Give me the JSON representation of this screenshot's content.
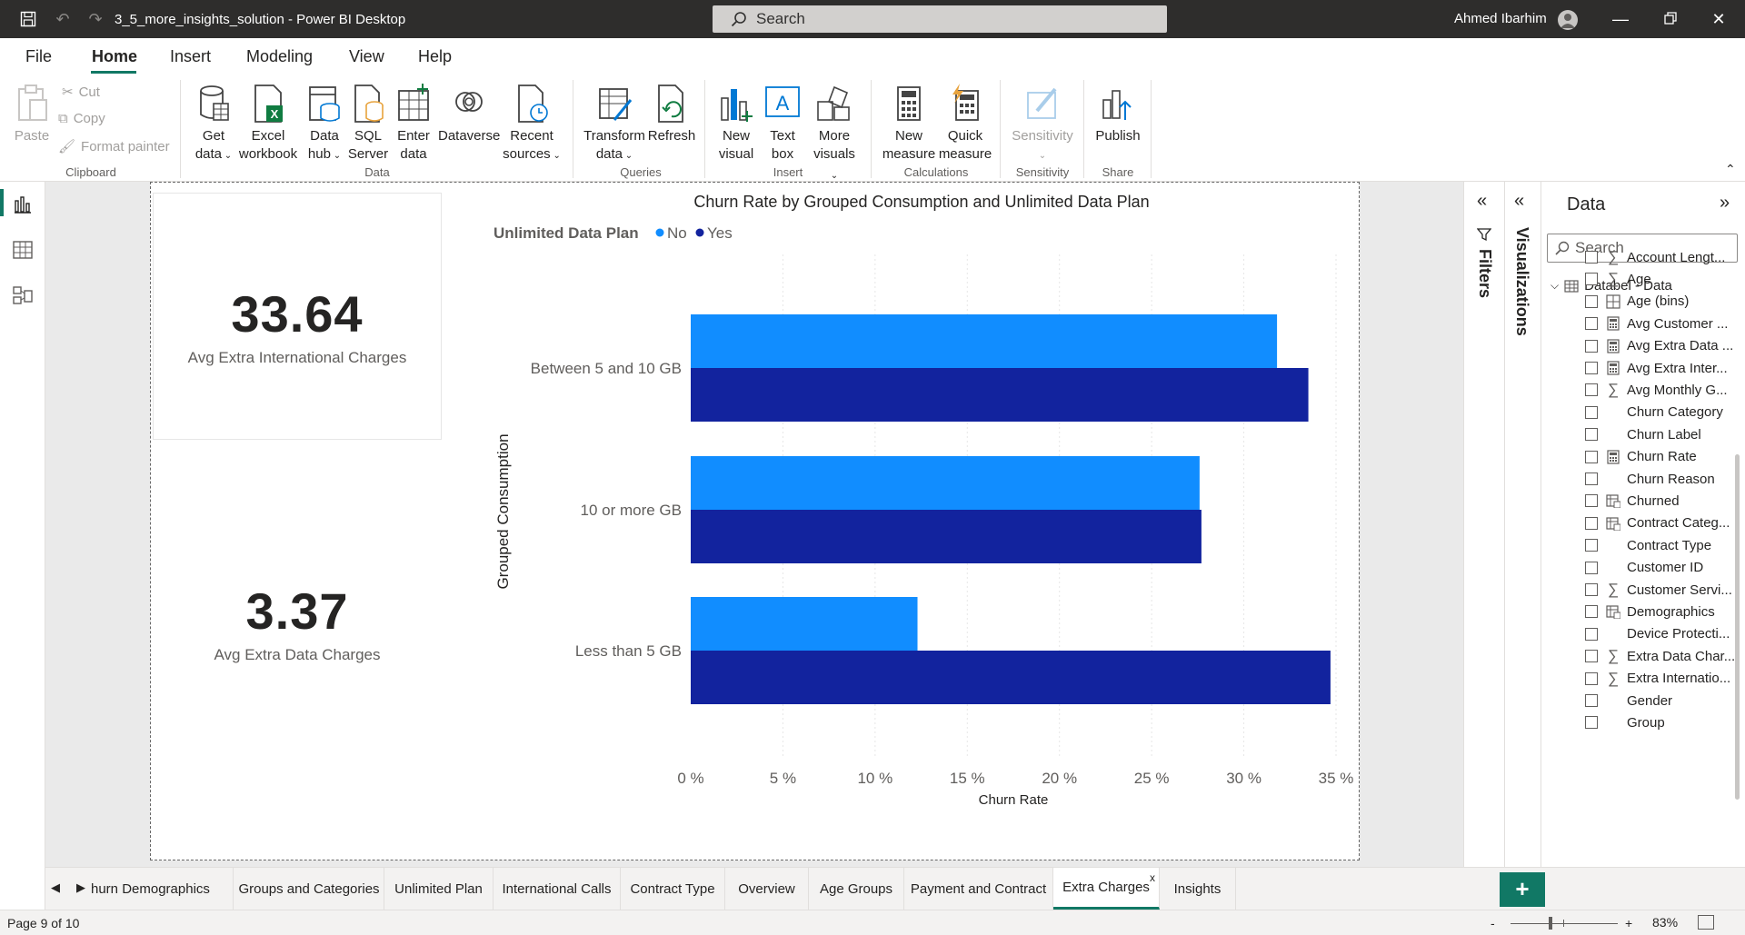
{
  "window": {
    "title": "3_5_more_insights_solution - Power BI Desktop",
    "search_placeholder": "Search",
    "user": "Ahmed Ibarhim"
  },
  "menu": {
    "items": [
      "File",
      "Home",
      "Insert",
      "Modeling",
      "View",
      "Help"
    ],
    "active": "Home"
  },
  "ribbon": {
    "clipboard": {
      "paste": "Paste",
      "cut": "Cut",
      "copy": "Copy",
      "format_painter": "Format painter",
      "label": "Clipboard"
    },
    "data": {
      "get_data": [
        "Get",
        "data"
      ],
      "excel": [
        "Excel",
        "workbook"
      ],
      "data_hub": [
        "Data",
        "hub"
      ],
      "sql": [
        "SQL",
        "Server"
      ],
      "enter": [
        "Enter",
        "data"
      ],
      "dataverse": "Dataverse",
      "recent": [
        "Recent",
        "sources"
      ],
      "label": "Data"
    },
    "queries": {
      "transform": [
        "Transform",
        "data"
      ],
      "refresh": "Refresh",
      "label": "Queries"
    },
    "insert": {
      "new_visual": [
        "New",
        "visual"
      ],
      "text_box": [
        "Text",
        "box"
      ],
      "more": [
        "More",
        "visuals"
      ],
      "label": "Insert"
    },
    "calculations": {
      "new_measure": [
        "New",
        "measure"
      ],
      "quick_measure": [
        "Quick",
        "measure"
      ],
      "label": "Calculations"
    },
    "sensitivity": {
      "btn": "Sensitivity",
      "label": "Sensitivity"
    },
    "share": {
      "publish": "Publish",
      "label": "Share"
    }
  },
  "cards": [
    {
      "value": "33.64",
      "label": "Avg Extra International Charges"
    },
    {
      "value": "3.37",
      "label": "Avg Extra Data Charges"
    }
  ],
  "chart_data": {
    "type": "bar",
    "orientation": "horizontal",
    "title": "Churn Rate by Grouped Consumption and Unlimited Data Plan",
    "legend_title": "Unlimited Data Plan",
    "legend_position": "top-left",
    "xlabel": "Churn Rate",
    "ylabel": "Grouped Consumption",
    "categories": [
      "Between 5 and 10 GB",
      "10 or more GB",
      "Less than 5 GB"
    ],
    "series": [
      {
        "name": "No",
        "color": "#118dff",
        "values": [
          31.8,
          27.6,
          12.3
        ]
      },
      {
        "name": "Yes",
        "color": "#12239e",
        "values": [
          33.5,
          27.7,
          34.7
        ]
      }
    ],
    "xlim": [
      0,
      35
    ],
    "xticks": [
      "0 %",
      "5 %",
      "10 %",
      "15 %",
      "20 %",
      "25 %",
      "30 %",
      "35 %"
    ],
    "xtick_values": [
      0,
      5,
      10,
      15,
      20,
      25,
      30,
      35
    ],
    "grid": true
  },
  "panes": {
    "filters": "Filters",
    "visualizations": "Visualizations",
    "data": {
      "title": "Data",
      "search_placeholder": "Search",
      "table": "Databel - Data",
      "fields": [
        {
          "name": "Account Lengt...",
          "icon": "sigma"
        },
        {
          "name": "Age",
          "icon": "sigma"
        },
        {
          "name": "Age (bins)",
          "icon": "bins"
        },
        {
          "name": "Avg Customer ...",
          "icon": "calc"
        },
        {
          "name": "Avg Extra Data ...",
          "icon": "calc"
        },
        {
          "name": "Avg Extra Inter...",
          "icon": "calc"
        },
        {
          "name": "Avg Monthly G...",
          "icon": "sigma"
        },
        {
          "name": "Churn Category",
          "icon": "none"
        },
        {
          "name": "Churn Label",
          "icon": "none"
        },
        {
          "name": "Churn Rate",
          "icon": "calc"
        },
        {
          "name": "Churn Reason",
          "icon": "none"
        },
        {
          "name": "Churned",
          "icon": "calccol"
        },
        {
          "name": "Contract Categ...",
          "icon": "calccol"
        },
        {
          "name": "Contract Type",
          "icon": "none"
        },
        {
          "name": "Customer ID",
          "icon": "none"
        },
        {
          "name": "Customer Servi...",
          "icon": "sigma"
        },
        {
          "name": "Demographics",
          "icon": "calccol"
        },
        {
          "name": "Device Protecti...",
          "icon": "none"
        },
        {
          "name": "Extra Data Char...",
          "icon": "sigma"
        },
        {
          "name": "Extra Internatio...",
          "icon": "sigma"
        },
        {
          "name": "Gender",
          "icon": "none"
        },
        {
          "name": "Group",
          "icon": "none"
        }
      ]
    }
  },
  "tabs": {
    "items": [
      "hurn Demographics",
      "Groups and Categories",
      "Unlimited Plan",
      "International Calls",
      "Contract Type",
      "Overview",
      "Age Groups",
      "Payment and Contract",
      "Extra Charges",
      "Insights"
    ],
    "active": "Extra Charges",
    "close": "x",
    "add": "+"
  },
  "status": {
    "page": "Page 9 of 10",
    "zoom": "83%",
    "minus": "-",
    "plus": "+"
  }
}
